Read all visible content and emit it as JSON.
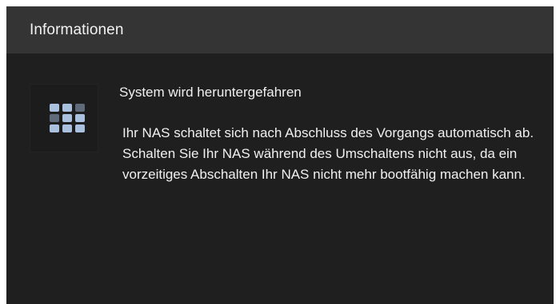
{
  "dialog": {
    "title": "Informationen",
    "icon": "app-grid-icon",
    "colors": {
      "titlebar": "#343434",
      "background": "#1f1f1f",
      "text": "#f0f0f0",
      "icon_accent": "#aac0df",
      "icon_muted": "#5f6b7a"
    },
    "headline": "System wird heruntergefahren",
    "detail": "Ihr NAS schaltet sich nach Abschluss des Vorgangs automatisch ab. Schalten Sie Ihr NAS während des Umschaltens nicht aus, da ein vorzeitiges Abschalten Ihr NAS nicht mehr bootfähig machen kann."
  }
}
